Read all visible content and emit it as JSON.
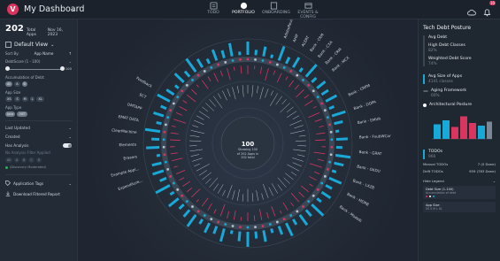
{
  "header": {
    "title": "My Dashboard",
    "nav": [
      {
        "label": "TODO",
        "icon": "checklist-icon"
      },
      {
        "label": "PORTFOLIO",
        "icon": "portfolio-icon",
        "active": true
      },
      {
        "label": "ONBOARDING",
        "icon": "onboarding-icon"
      },
      {
        "label": "EVENTS & CONFIG",
        "icon": "events-icon"
      }
    ],
    "notification_count": "10"
  },
  "left": {
    "total": "202",
    "total_label": "Total Apps",
    "date": "Nov 16, 2023",
    "view_label": "Default View",
    "sort_label": "Sort By:",
    "sort_value": "App Name",
    "debt_label": "DebtScore (1 - 100)",
    "debt_max": "100",
    "accum_label": "Accumulation of Debt:",
    "accum_chips": [
      "All",
      "A",
      "B",
      "C",
      "D"
    ],
    "app_size_label": "App Size",
    "size_chips": [
      "XS",
      "S",
      "M",
      "L",
      "XL"
    ],
    "app_type_label": "App Type",
    "type_chips": [
      "Java",
      ".NET"
    ],
    "last_updated": "Last Updated",
    "created": "Created",
    "has_analysis": "Has Analysis",
    "no_analysis_label": "No Analysis Filter Applied",
    "dim_chips": [
      "All",
      "A",
      "B",
      "C",
      "D"
    ],
    "discovery": "(Discovery Moderated)",
    "app_tags": "Application Tags",
    "download": "Download Filtered Report"
  },
  "center": {
    "count": "100",
    "lines": [
      "Showing 100",
      "of 202 Apps in",
      "202 total"
    ],
    "bars": [
      {
        "blue": 0.75,
        "pink": 0.55,
        "line": 0.4
      },
      {
        "blue": 0.3,
        "pink": 0.2,
        "line": 0.55
      },
      {
        "blue": 0.55,
        "pink": 0.45,
        "line": 0.35
      },
      {
        "blue": 0.2,
        "pink": 0.8,
        "line": 0.6
      },
      {
        "blue": 0.85,
        "pink": 0.3,
        "line": 0.45
      },
      {
        "blue": 0.4,
        "pink": 0.65,
        "line": 0.25
      },
      {
        "blue": 0.65,
        "pink": 0.25,
        "line": 0.7
      },
      {
        "blue": 0.25,
        "pink": 0.5,
        "line": 0.5
      },
      {
        "blue": 0.9,
        "pink": 0.4,
        "line": 0.3
      },
      {
        "blue": 0.35,
        "pink": 0.7,
        "line": 0.65
      },
      {
        "blue": 0.6,
        "pink": 0.35,
        "line": 0.4
      },
      {
        "blue": 0.45,
        "pink": 0.6,
        "line": 0.55
      },
      {
        "blue": 0.7,
        "pink": 0.2,
        "line": 0.35
      },
      {
        "blue": 0.3,
        "pink": 0.75,
        "line": 0.6
      },
      {
        "blue": 0.8,
        "pink": 0.45,
        "line": 0.45
      },
      {
        "blue": 0.5,
        "pink": 0.3,
        "line": 0.7
      },
      {
        "blue": 0.2,
        "pink": 0.55,
        "line": 0.3
      },
      {
        "blue": 0.65,
        "pink": 0.65,
        "line": 0.5
      },
      {
        "blue": 0.35,
        "pink": 0.25,
        "line": 0.4
      },
      {
        "blue": 0.85,
        "pink": 0.7,
        "line": 0.6
      },
      {
        "blue": 0.55,
        "pink": 0.4,
        "line": 0.35
      },
      {
        "blue": 0.25,
        "pink": 0.8,
        "line": 0.55
      },
      {
        "blue": 0.75,
        "pink": 0.35,
        "line": 0.45
      },
      {
        "blue": 0.4,
        "pink": 0.5,
        "line": 0.65
      },
      {
        "blue": 0.6,
        "pink": 0.25,
        "line": 0.3
      },
      {
        "blue": 0.3,
        "pink": 0.6,
        "line": 0.5
      },
      {
        "blue": 0.9,
        "pink": 0.45,
        "line": 0.4
      },
      {
        "blue": 0.45,
        "pink": 0.75,
        "line": 0.6
      },
      {
        "blue": 0.7,
        "pink": 0.3,
        "line": 0.35
      },
      {
        "blue": 0.35,
        "pink": 0.55,
        "line": 0.55
      },
      {
        "blue": 0.8,
        "pink": 0.2,
        "line": 0.45
      },
      {
        "blue": 0.5,
        "pink": 0.65,
        "line": 0.7
      },
      {
        "blue": 0.25,
        "pink": 0.4,
        "line": 0.3
      },
      {
        "blue": 0.65,
        "pink": 0.7,
        "line": 0.5
      },
      {
        "blue": 0.4,
        "pink": 0.35,
        "line": 0.4
      },
      {
        "blue": 0.85,
        "pink": 0.55,
        "line": 0.6
      },
      {
        "blue": 0.55,
        "pink": 0.25,
        "line": 0.35
      },
      {
        "blue": 0.2,
        "pink": 0.6,
        "line": 0.55
      },
      {
        "blue": 0.75,
        "pink": 0.45,
        "line": 0.45
      },
      {
        "blue": 0.45,
        "pink": 0.8,
        "line": 0.65
      },
      {
        "blue": 0.6,
        "pink": 0.3,
        "line": 0.3
      },
      {
        "blue": 0.3,
        "pink": 0.5,
        "line": 0.5
      },
      {
        "blue": 0.8,
        "pink": 0.65,
        "line": 0.4
      },
      {
        "blue": 0.5,
        "pink": 0.2,
        "line": 0.6
      },
      {
        "blue": 0.35,
        "pink": 0.75,
        "line": 0.35
      },
      {
        "blue": 0.7,
        "pink": 0.4,
        "line": 0.55
      },
      {
        "blue": 0.25,
        "pink": 0.55,
        "line": 0.45
      },
      {
        "blue": 0.9,
        "pink": 0.35,
        "line": 0.7
      },
      {
        "blue": 0.4,
        "pink": 0.6,
        "line": 0.3
      },
      {
        "blue": 0.65,
        "pink": 0.25,
        "line": 0.5
      },
      {
        "blue": 0.55,
        "pink": 0.7,
        "line": 0.4
      },
      {
        "blue": 0.2,
        "pink": 0.45,
        "line": 0.6
      },
      {
        "blue": 0.75,
        "pink": 0.3,
        "line": 0.35
      },
      {
        "blue": 0.45,
        "pink": 0.65,
        "line": 0.55
      },
      {
        "blue": 0.85,
        "pink": 0.5,
        "line": 0.45
      },
      {
        "blue": 0.3,
        "pink": 0.25,
        "line": 0.65
      },
      {
        "blue": 0.6,
        "pink": 0.8,
        "line": 0.3
      },
      {
        "blue": 0.35,
        "pink": 0.4,
        "line": 0.5
      },
      {
        "blue": 0.8,
        "pink": 0.55,
        "line": 0.4
      },
      {
        "blue": 0.5,
        "pink": 0.3,
        "line": 0.6
      },
      {
        "blue": 0.25,
        "pink": 0.7,
        "line": 0.35
      },
      {
        "blue": 0.7,
        "pink": 0.45,
        "line": 0.55
      },
      {
        "blue": 0.4,
        "pink": 0.2,
        "line": 0.45
      },
      {
        "blue": 0.9,
        "pink": 0.65,
        "line": 0.7
      },
      {
        "blue": 0.55,
        "pink": 0.35,
        "line": 0.3
      },
      {
        "blue": 0.3,
        "pink": 0.6,
        "line": 0.5
      },
      {
        "blue": 0.65,
        "pink": 0.4,
        "line": 0.4
      },
      {
        "blue": 0.45,
        "pink": 0.75,
        "line": 0.6
      },
      {
        "blue": 0.75,
        "pink": 0.25,
        "line": 0.35
      },
      {
        "blue": 0.2,
        "pink": 0.5,
        "line": 0.55
      }
    ],
    "labels_left": [
      "Expenditure...",
      "Example Appl...",
      "Erasers",
      "Elements",
      "ClearMachine",
      "EMAT DATA",
      "DMTAPP",
      "ECT",
      "Feedback"
    ],
    "labels_top": [
      "AdobeReview",
      "AHIF",
      "ALERT",
      "Bank - CRM",
      "Bank - CXA",
      "Bank - CRM",
      "Bank - MCX"
    ],
    "labels_right": [
      "Bank - CRPM",
      "Bank - DOPA",
      "Bank - EMVR",
      "Bank - FsubWCar",
      "Bank - GRAT",
      "Bank - GKDU",
      "Bank - LXZB",
      "Bank - MDRB",
      "Bank - Modelli"
    ]
  },
  "right": {
    "title": "Tech Debt Posture",
    "avg_debt": "Avg Debt",
    "hdc_label": "High Debt Classes",
    "hdc_value": "82%",
    "wds_label": "Weighted Debt Score",
    "wds_value": "74%",
    "avg_size_label": "Avg Size of Apps",
    "avg_size_value": "4141 classes",
    "aging_label": "Aging Framework",
    "aging_value": "60%",
    "arch_label": "Architectural Posture",
    "arch_bars": [
      0.55,
      0.7,
      0.45,
      0.85,
      0.6,
      0.5,
      0.65
    ],
    "todos_label": "TODOs",
    "todos_value": "966",
    "manual_label": "Manual TODOs",
    "manual_value": "7 (0 Done)",
    "drift_label": "Drift TODOs",
    "drift_value": "959 (783 Done)",
    "legend_label": "Hide Legend",
    "legend_card1_title": "Debt Size (1-100)",
    "legend_card1_sub": "Accumulation of debt",
    "legend_card2_title": "App Size",
    "legend_card2_sub": "XS S M L XL"
  },
  "colors": {
    "accent_pink": "#d9365f",
    "accent_blue": "#18a9d8"
  }
}
